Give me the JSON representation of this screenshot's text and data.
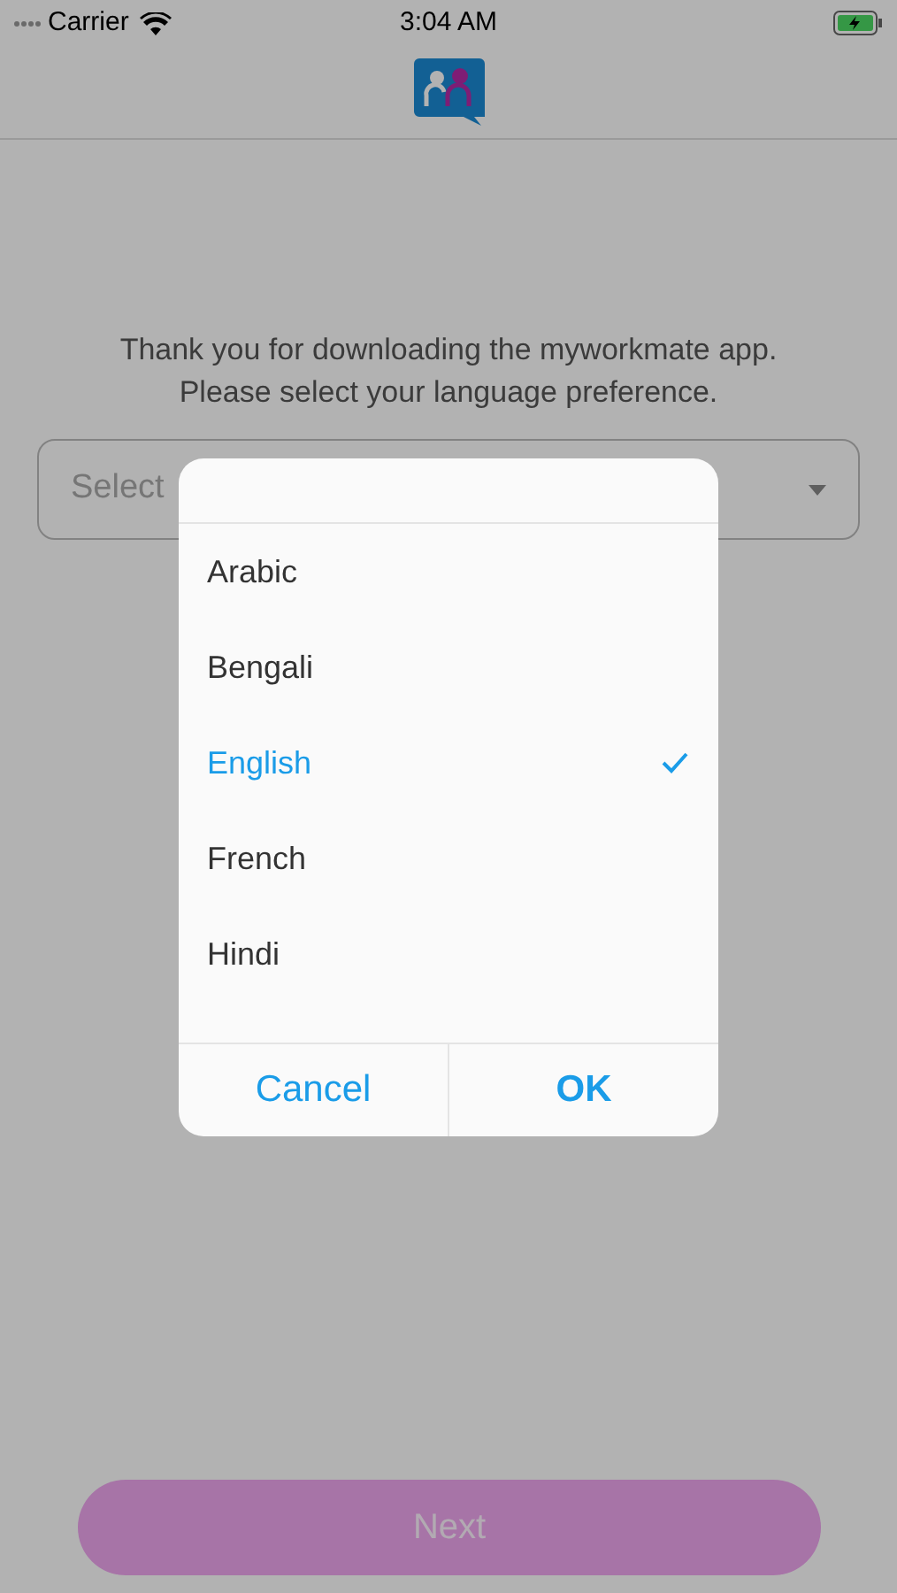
{
  "status_bar": {
    "carrier": "Carrier",
    "time": "3:04 AM"
  },
  "intro": [
    "Thank you for downloading the myworkmate app.",
    "Please select your language preference."
  ],
  "language_select": {
    "placeholder": "Select"
  },
  "dialog": {
    "options": [
      {
        "label": "Arabic",
        "selected": false
      },
      {
        "label": "Bengali",
        "selected": false
      },
      {
        "label": "English",
        "selected": true
      },
      {
        "label": "French",
        "selected": false
      },
      {
        "label": "Hindi",
        "selected": false
      }
    ],
    "buttons": [
      "Cancel",
      "OK"
    ]
  },
  "next_button": {
    "label": "Next",
    "disabled": true
  }
}
